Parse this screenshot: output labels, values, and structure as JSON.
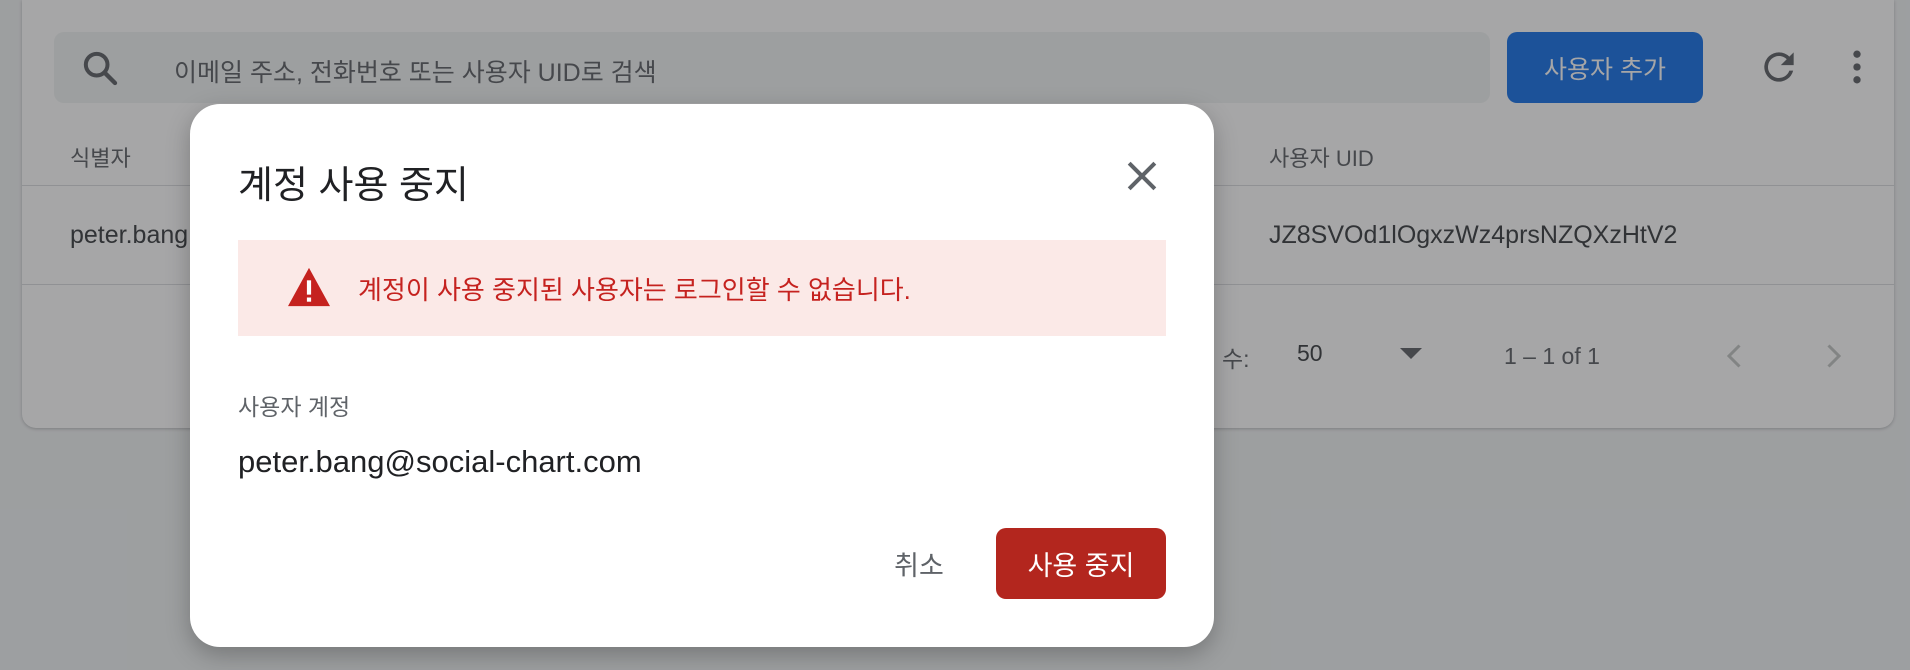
{
  "search": {
    "placeholder": "이메일 주소, 전화번호 또는 사용자 UID로 검색"
  },
  "toolbar": {
    "add_user_label": "사용자 추가"
  },
  "table": {
    "headers": [
      "식별자",
      "사용자 UID"
    ],
    "rows": [
      {
        "identifier": "peter.bang",
        "uid": "JZ8SVOd1lOgxzWz4prsNZQXzHtV2"
      }
    ]
  },
  "pagination": {
    "rows_label": "수:",
    "rows_per_page": "50",
    "range": "1 – 1 of 1"
  },
  "dialog": {
    "title": "계정 사용 중지",
    "warning": "계정이 사용 중지된 사용자는 로그인할 수 없습니다.",
    "account_label": "사용자 계정",
    "account_value": "peter.bang@social-chart.com",
    "cancel_label": "취소",
    "confirm_label": "사용 중지"
  },
  "colors": {
    "primary": "#1a73e8",
    "danger": "#b3261e",
    "warning_bg": "#fbe9e7",
    "warning_text": "#c5221f"
  }
}
